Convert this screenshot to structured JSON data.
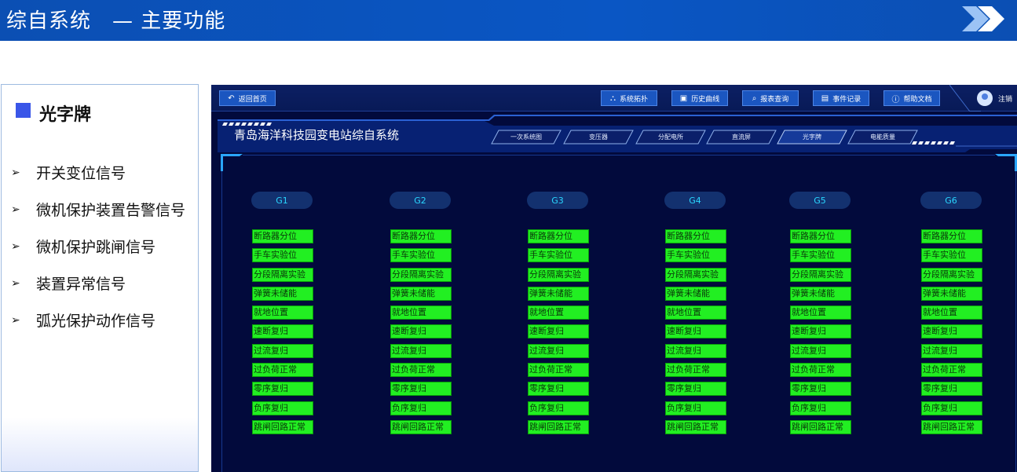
{
  "banner": {
    "title": "综自系统　—  主要功能"
  },
  "sidebar": {
    "title": "光字牌",
    "items": [
      {
        "label": "开关变位信号"
      },
      {
        "label": "微机保护装置告警信号"
      },
      {
        "label": "微机保护跳闸信号"
      },
      {
        "label": "装置异常信号"
      },
      {
        "label": "弧光保护动作信号"
      }
    ]
  },
  "app": {
    "toolbar": {
      "home": {
        "label": "返回首页",
        "icon": "back-arrow-icon"
      },
      "buttons": [
        {
          "label": "系统拓扑",
          "icon": "topology-icon"
        },
        {
          "label": "历史曲线",
          "icon": "chart-icon"
        },
        {
          "label": "报表查询",
          "icon": "search-icon"
        },
        {
          "label": "事件记录",
          "icon": "document-icon"
        },
        {
          "label": "帮助文档",
          "icon": "help-icon"
        }
      ],
      "logout": "注销"
    },
    "station_title": "青岛海洋科技园变电站综自系统",
    "nav_tabs": [
      {
        "label": "一次系统图"
      },
      {
        "label": "变压器"
      },
      {
        "label": "分配电所"
      },
      {
        "label": "直流屏"
      },
      {
        "label": "光字牌"
      },
      {
        "label": "电能质量"
      }
    ],
    "groups": [
      {
        "label": "G1"
      },
      {
        "label": "G2"
      },
      {
        "label": "G3"
      },
      {
        "label": "G4"
      },
      {
        "label": "G5"
      },
      {
        "label": "G6"
      }
    ],
    "signals": [
      "断路器分位",
      "手车实验位",
      "分段隔离实验",
      "弹簧未储能",
      "就地位置",
      "速断复归",
      "过流复归",
      "过负荷正常",
      "零序复归",
      "负序复归",
      "跳闸回路正常"
    ],
    "colors": {
      "signal_on": "#22ef22",
      "panel_bg": "#020a3c",
      "button": "#1b56c0"
    }
  }
}
